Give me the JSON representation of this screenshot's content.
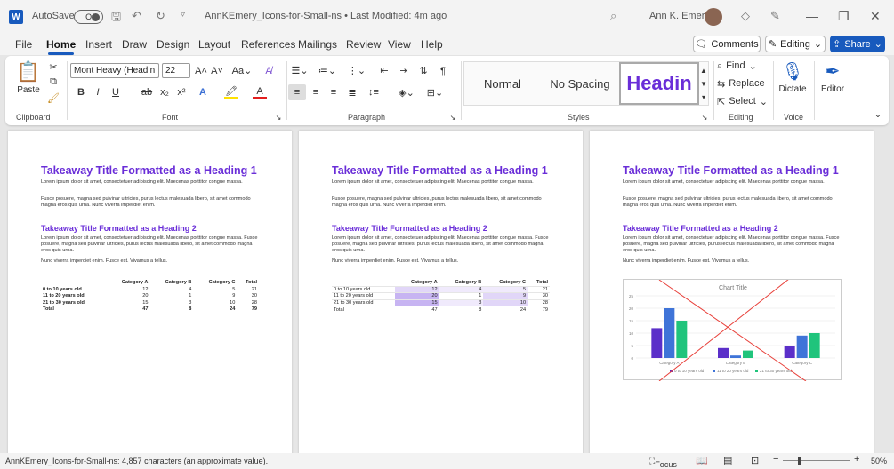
{
  "titlebar": {
    "app_icon": "W",
    "autosave": "AutoSave",
    "toggle": "Off",
    "doc_title": "AnnKEmery_Icons-for-Small-ns • Last Modified: 4m ago",
    "user": "Ann K. Emery"
  },
  "menu": [
    "File",
    "Home",
    "Insert",
    "Draw",
    "Design",
    "Layout",
    "References",
    "Mailings",
    "Review",
    "View",
    "Help"
  ],
  "actions": {
    "comments": "Comments",
    "editing": "Editing",
    "share": "Share"
  },
  "ribbon": {
    "clipboard": {
      "paste": "Paste",
      "label": "Clipboard"
    },
    "font": {
      "name": "Mont Heavy (Headin",
      "size": "22",
      "label": "Font"
    },
    "paragraph": {
      "label": "Paragraph"
    },
    "styles": {
      "normal": "Normal",
      "nospacing": "No Spacing",
      "heading": "Headin",
      "label": "Styles"
    },
    "editing": {
      "find": "Find",
      "replace": "Replace",
      "select": "Select",
      "label": "Editing"
    },
    "voice": {
      "dictate": "Dictate",
      "label": "Voice"
    },
    "editor": {
      "label": "Editor"
    }
  },
  "doc": {
    "h1": "Takeaway Title Formatted as a Heading 1",
    "p1": "Lorem ipsum dolor sit amet, consectetuer adipiscing elit. Maecenas porttitor congue massa.",
    "p2": "Fusce posuere, magna sed pulvinar ultricies, purus lectus malesuada libero, sit amet commodo magna eros quis urna. Nunc viverra imperdiet enim.",
    "h2": "Takeaway Title Formatted as a Heading 2",
    "p3": "Lorem ipsum dolor sit amet, consectetuer adipiscing elit. Maecenas porttitor congue massa. Fusce posuere, magna sed pulvinar ultricies, purus lectus malesuada libero, sit amet commodo magna eros quis urna.",
    "p4": "Nunc viverra imperdiet enim. Fusce est. Vivamus a tellus.",
    "table": {
      "headers": [
        "",
        "Category A",
        "Category B",
        "Category C",
        "Total"
      ],
      "rows": [
        [
          "0 to 10 years old",
          "12",
          "4",
          "5",
          "21"
        ],
        [
          "11 to 20 years old",
          "20",
          "1",
          "9",
          "30"
        ],
        [
          "21 to 30 years old",
          "15",
          "3",
          "10",
          "28"
        ],
        [
          "Total",
          "47",
          "8",
          "24",
          "79"
        ]
      ]
    }
  },
  "chart_data": {
    "type": "bar",
    "title": "Chart Title",
    "categories": [
      "Category A",
      "Category B",
      "Category C"
    ],
    "series": [
      {
        "name": "0 to 10 years old",
        "values": [
          12,
          4,
          5
        ],
        "color": "#5b2fc9"
      },
      {
        "name": "11 to 20 years old",
        "values": [
          20,
          1,
          9
        ],
        "color": "#3f74d8"
      },
      {
        "name": "21 to 30 years old",
        "values": [
          15,
          3,
          10
        ],
        "color": "#20c47c"
      }
    ],
    "ylim": [
      0,
      25
    ],
    "yticks": [
      0,
      5,
      10,
      15,
      20,
      25
    ],
    "legend": "bottom",
    "crossed_out": true
  },
  "status": {
    "words": "AnnKEmery_Icons-for-Small-ns: 4,857 characters (an approximate value).",
    "focus": "Focus",
    "zoom": "50%"
  }
}
